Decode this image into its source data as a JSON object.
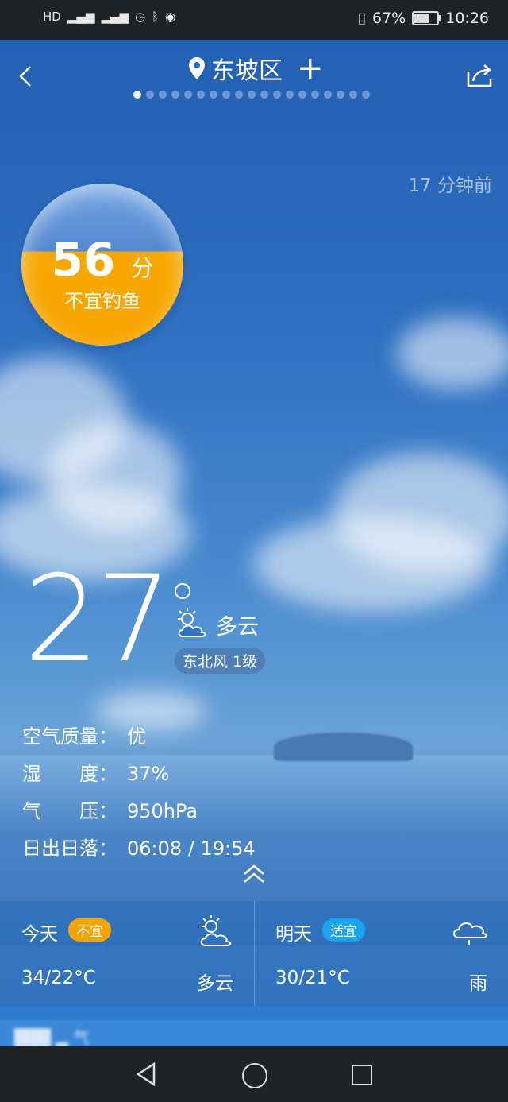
{
  "status_bar": {
    "left_icons": [
      "hd-icon",
      "4g-signal-icon",
      "signal-icon",
      "alarm-icon",
      "bluetooth-icon",
      "globe-icon"
    ],
    "vibrate_icon": "vibrate-icon",
    "battery_percent": "67%",
    "battery_level": 0.67,
    "time": "10:26"
  },
  "header": {
    "location": "东坡区",
    "add_label": "+",
    "page_count": 19,
    "active_page": 0
  },
  "updated": "17 分钟前",
  "fishing": {
    "score": "56",
    "unit": "分",
    "advice": "不宜钓鱼",
    "level": 0.56
  },
  "current": {
    "temperature": "27",
    "condition": "多云",
    "wind": "东北风 1级"
  },
  "details": [
    {
      "label": "空气质量：",
      "value": "优"
    },
    {
      "label": "湿　　度：",
      "value": "37%"
    },
    {
      "label": "气　　压：",
      "value": "950hPa"
    },
    {
      "label": "日出日落：",
      "value": "06:08 / 19:54"
    }
  ],
  "forecast": {
    "today": {
      "day": "今天",
      "badge": "不宜",
      "temp": "34/22°C",
      "condition": "多云"
    },
    "tomorrow": {
      "day": "明天",
      "badge": "适宜",
      "temp": "30/21°C",
      "condition": "雨"
    }
  },
  "colors": {
    "accent_warning": "#f4a500",
    "accent_ok": "#1aa3f0",
    "sky": "#2f71c2"
  }
}
